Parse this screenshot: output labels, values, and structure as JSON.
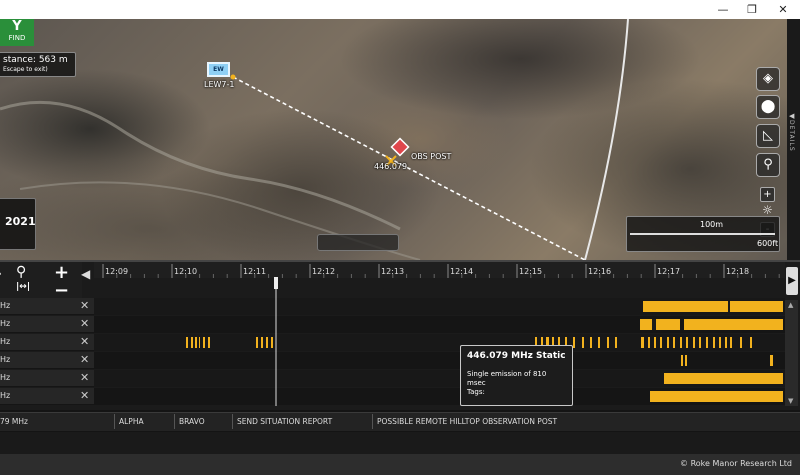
{
  "window": {
    "controls": [
      {
        "name": "minimize",
        "glyph": "—"
      },
      {
        "name": "maximize",
        "glyph": "❐"
      },
      {
        "name": "close",
        "glyph": "✕"
      }
    ]
  },
  "find_button": {
    "icon": "Y",
    "label": "FIND"
  },
  "distance_box": {
    "line1": "stance: 563 m",
    "line2": "Escape to exit)"
  },
  "year_label": "2021",
  "map": {
    "ew_icon_text": "EW",
    "ew_label": "LEW7-1",
    "post_label": "OBS POST",
    "freq_label": "446.079",
    "details_label": "DETAILS"
  },
  "scale": {
    "meters": "100m",
    "feet": "600ft"
  },
  "zoom": {
    "plus": "+",
    "minus": "-"
  },
  "timeline": {
    "ticks": [
      "12:09",
      "12:10",
      "12:11",
      "12:12",
      "12:13",
      "12:14",
      "12:15",
      "12:16",
      "12:17",
      "12:18"
    ],
    "rows": [
      {
        "label": "Hz"
      },
      {
        "label": "Hz"
      },
      {
        "label": "Hz"
      },
      {
        "label": "Hz"
      },
      {
        "label": "Hz"
      },
      {
        "label": "Hz"
      }
    ]
  },
  "tooltip": {
    "title": "446.079 MHz Static",
    "detail": "Single emission of 810 msec",
    "tags": "Tags:"
  },
  "situation_bar": {
    "frequency": "79 MHz",
    "alpha": "ALPHA",
    "bravo": "BRAVO",
    "action": "SEND SITUATION REPORT",
    "description": "POSSIBLE REMOTE HILLTOP OBSERVATION POST"
  },
  "footer": {
    "copyright": "© Roke Manor Research Ltd"
  },
  "colors": {
    "activity": "#f2b21e",
    "find_green": "#2a8f3a",
    "ew_blue": "#8fd0f5",
    "post_red": "#e0474c"
  }
}
